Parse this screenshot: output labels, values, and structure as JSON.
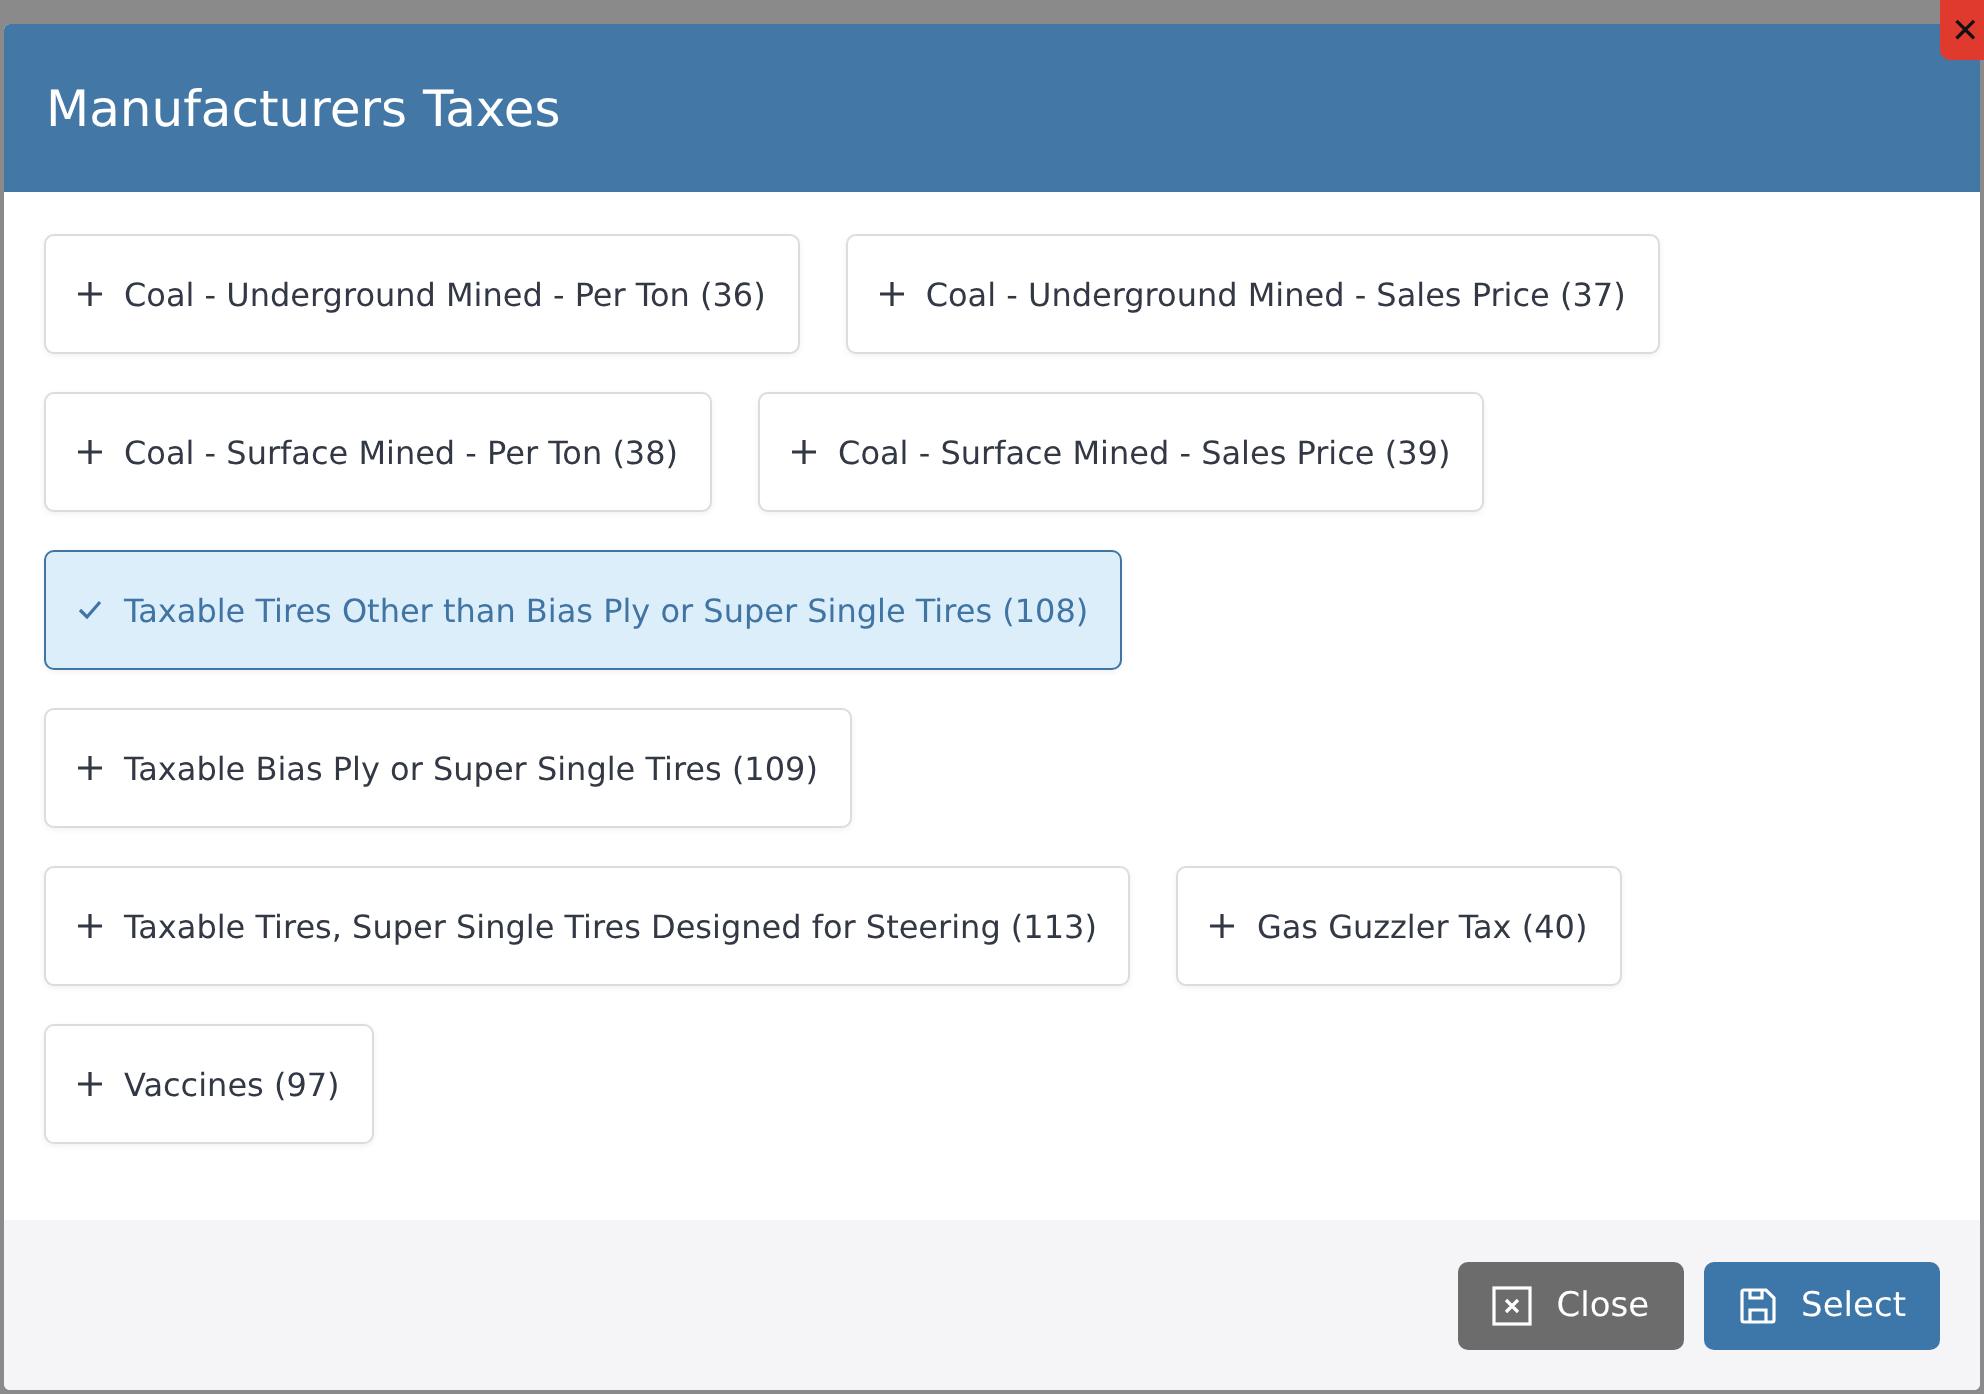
{
  "dialog": {
    "title": "Manufacturers Taxes",
    "close_glyph": "✕"
  },
  "option_rows": [
    {
      "items": [
        {
          "label": "Coal - Underground Mined - Per Ton (36)",
          "selected": false
        },
        {
          "label": "Coal - Underground Mined - Sales Price (37)",
          "selected": false
        }
      ]
    },
    {
      "items": [
        {
          "label": "Coal - Surface Mined - Per Ton (38)",
          "selected": false
        },
        {
          "label": "Coal - Surface Mined - Sales Price (39)",
          "selected": false
        }
      ]
    },
    {
      "items": [
        {
          "label": "Taxable Tires Other than Bias Ply or Super Single Tires (108)",
          "selected": true
        }
      ]
    },
    {
      "items": [
        {
          "label": "Taxable Bias Ply or Super Single Tires (109)",
          "selected": false
        }
      ]
    },
    {
      "items": [
        {
          "label": "Taxable Tires, Super Single Tires Designed for Steering (113)",
          "selected": false
        },
        {
          "label": "Gas Guzzler Tax (40)",
          "selected": false
        }
      ]
    },
    {
      "items": [
        {
          "label": "Vaccines (97)",
          "selected": false
        }
      ]
    }
  ],
  "buttons": [
    {
      "label": "Close",
      "kind": "close"
    },
    {
      "label": "Select",
      "kind": "select"
    }
  ]
}
